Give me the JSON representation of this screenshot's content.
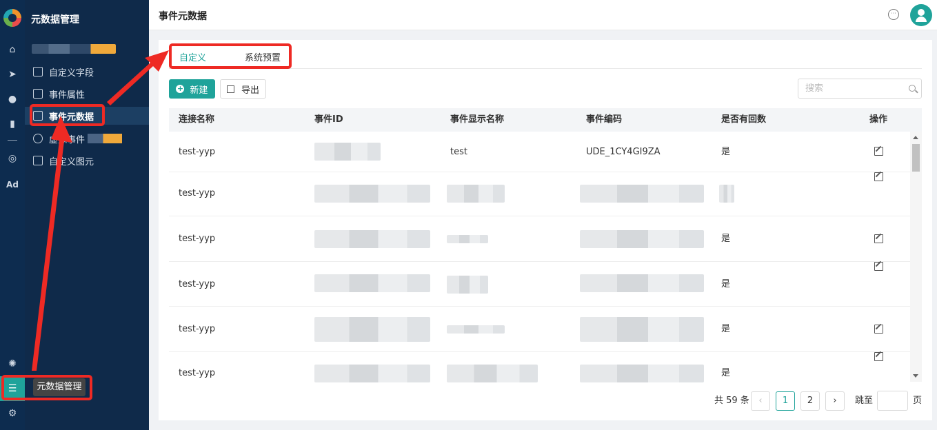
{
  "rail": {
    "icons": [
      "logo-icon",
      "home-icon",
      "send-icon",
      "user-icon",
      "bar-chart-icon",
      "wechat-icon",
      "ad-icon",
      "settings-circle-icon",
      "metadata-icon",
      "gear-icon"
    ],
    "ad_label": "Ad"
  },
  "sidebar": {
    "title": "元数据管理",
    "items": [
      {
        "label": "自定义字段"
      },
      {
        "label": "事件属性"
      },
      {
        "label": "事件元数据"
      },
      {
        "label": "虚拟事件"
      },
      {
        "label": "自定义图元"
      }
    ]
  },
  "header": {
    "title": "事件元数据"
  },
  "tabs": [
    {
      "label": "自定义",
      "active": true
    },
    {
      "label": "系统预置",
      "active": false
    }
  ],
  "toolbar": {
    "new_label": "新建",
    "export_label": "导出",
    "search_placeholder": "搜索"
  },
  "table": {
    "columns": [
      "连接名称",
      "事件ID",
      "事件显示名称",
      "事件编码",
      "是否有回数",
      "操作"
    ],
    "rows": [
      {
        "conn": "test-yyp",
        "name": "test",
        "code": "UDE_1CY4GI9ZA",
        "has_return": "是"
      },
      {
        "conn": "test-yyp",
        "name": "",
        "code": "",
        "has_return": ""
      },
      {
        "conn": "test-yyp",
        "name": "",
        "code": "",
        "has_return": "是"
      },
      {
        "conn": "test-yyp",
        "name": "",
        "code": "",
        "has_return": "是"
      },
      {
        "conn": "test-yyp",
        "name": "",
        "code": "",
        "has_return": "是"
      },
      {
        "conn": "test-yyp",
        "name": "",
        "code": "",
        "has_return": "是"
      }
    ]
  },
  "pagination": {
    "total": "共 59 条",
    "pages": [
      "1",
      "2"
    ],
    "current": "1",
    "jump_label": "跳至",
    "page_suffix": "页"
  },
  "tooltip": "元数据管理",
  "colors": {
    "accent": "#1fa39a",
    "sidebar": "#0f2a4a",
    "annotation": "#ee2a24"
  }
}
